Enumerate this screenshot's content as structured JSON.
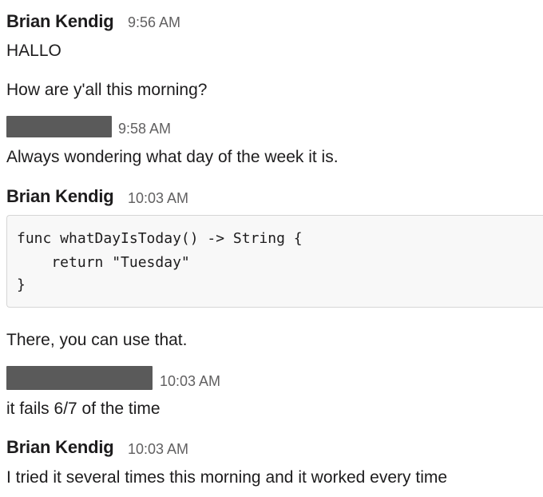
{
  "messages": [
    {
      "author": "Brian Kendig",
      "time": "9:56 AM",
      "lines": [
        "HALLO",
        "How are y'all this morning?"
      ]
    },
    {
      "author": "",
      "author_redacted": true,
      "time": "9:58 AM",
      "lines": [
        "Always wondering what day of the week it is."
      ]
    },
    {
      "author": "Brian Kendig",
      "time": "10:03 AM",
      "code": [
        "func whatDayIsToday() -> String {",
        "    return \"Tuesday\"",
        "}"
      ],
      "lines": [
        "There, you can use that."
      ]
    },
    {
      "author": "",
      "author_redacted": true,
      "time": "10:03 AM",
      "lines": [
        "it fails 6/7 of the time"
      ]
    },
    {
      "author": "Brian Kendig",
      "time": "10:03 AM",
      "lines": [
        "I tried it several times this morning and it worked every time"
      ]
    }
  ],
  "colors": {
    "text": "#1d1c1d",
    "timestamp": "#616061",
    "redaction": "#5a5a5a",
    "code_bg": "#f8f8f8",
    "code_border": "#d6d6d6"
  }
}
